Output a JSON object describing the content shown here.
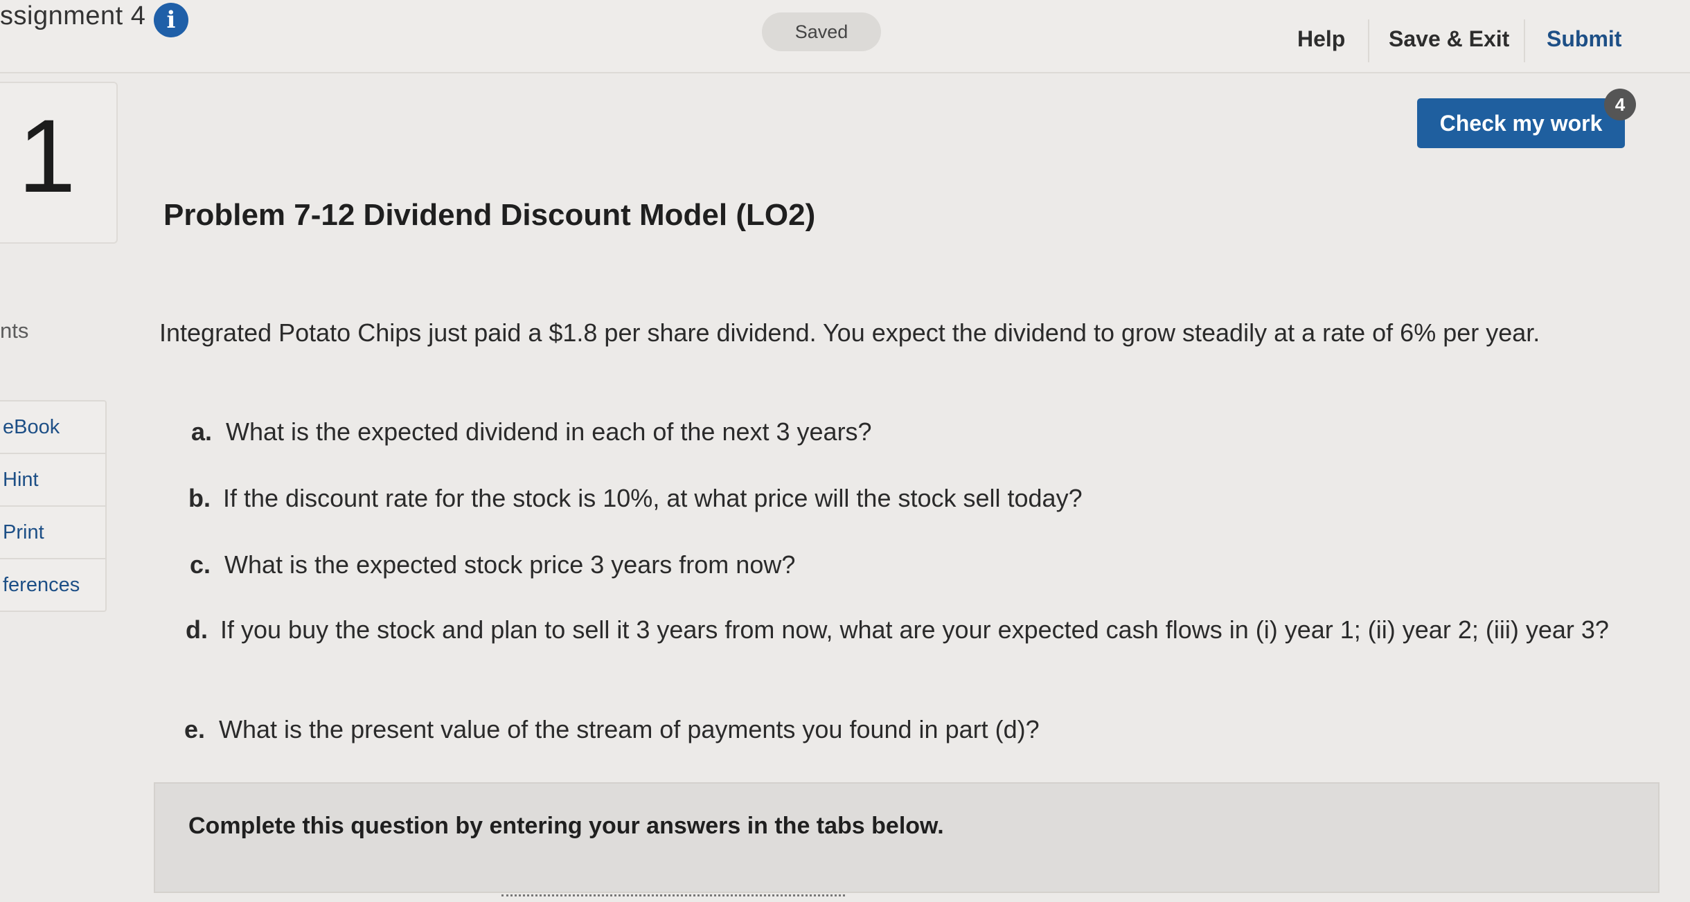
{
  "header": {
    "assignment_title": "ssignment 4",
    "info_icon": "info-icon",
    "saved_label": "Saved",
    "help_label": "Help",
    "save_exit_label": "Save & Exit",
    "submit_label": "Submit"
  },
  "question_number": "1",
  "points_label": "nts",
  "side_tools": [
    "eBook",
    "Hint",
    "Print",
    "ferences"
  ],
  "check_work": {
    "label": "Check my work",
    "badge": "4"
  },
  "problem": {
    "title": "Problem 7-12 Dividend Discount Model (LO2)",
    "intro": "Integrated Potato Chips just paid a $1.8 per share dividend. You expect the dividend to grow steadily at a rate of 6% per year.",
    "questions": [
      {
        "letter": "a.",
        "text": "What is the expected dividend in each of the next 3 years?"
      },
      {
        "letter": "b.",
        "text": "If the discount rate for the stock is 10%, at what price will the stock sell today?"
      },
      {
        "letter": "c.",
        "text": "What is the expected stock price 3 years from now?"
      },
      {
        "letter": "d.",
        "text": "If you buy the stock and plan to sell it 3 years from now, what are your expected cash flows in (i) year 1; (ii) year 2; (iii) year 3?"
      },
      {
        "letter": "e.",
        "text": "What is the present value of the stream of payments you found in part (d)?"
      }
    ]
  },
  "answers_instruction": "Complete this question by entering your answers in the tabs below."
}
